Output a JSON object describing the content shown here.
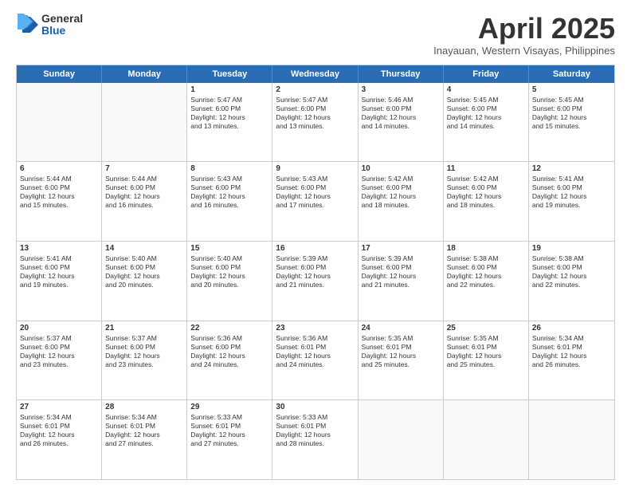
{
  "logo": {
    "general": "General",
    "blue": "Blue"
  },
  "title": "April 2025",
  "subtitle": "Inayauan, Western Visayas, Philippines",
  "header_days": [
    "Sunday",
    "Monday",
    "Tuesday",
    "Wednesday",
    "Thursday",
    "Friday",
    "Saturday"
  ],
  "weeks": [
    [
      {
        "day": "",
        "lines": []
      },
      {
        "day": "",
        "lines": []
      },
      {
        "day": "1",
        "lines": [
          "Sunrise: 5:47 AM",
          "Sunset: 6:00 PM",
          "Daylight: 12 hours",
          "and 13 minutes."
        ]
      },
      {
        "day": "2",
        "lines": [
          "Sunrise: 5:47 AM",
          "Sunset: 6:00 PM",
          "Daylight: 12 hours",
          "and 13 minutes."
        ]
      },
      {
        "day": "3",
        "lines": [
          "Sunrise: 5:46 AM",
          "Sunset: 6:00 PM",
          "Daylight: 12 hours",
          "and 14 minutes."
        ]
      },
      {
        "day": "4",
        "lines": [
          "Sunrise: 5:45 AM",
          "Sunset: 6:00 PM",
          "Daylight: 12 hours",
          "and 14 minutes."
        ]
      },
      {
        "day": "5",
        "lines": [
          "Sunrise: 5:45 AM",
          "Sunset: 6:00 PM",
          "Daylight: 12 hours",
          "and 15 minutes."
        ]
      }
    ],
    [
      {
        "day": "6",
        "lines": [
          "Sunrise: 5:44 AM",
          "Sunset: 6:00 PM",
          "Daylight: 12 hours",
          "and 15 minutes."
        ]
      },
      {
        "day": "7",
        "lines": [
          "Sunrise: 5:44 AM",
          "Sunset: 6:00 PM",
          "Daylight: 12 hours",
          "and 16 minutes."
        ]
      },
      {
        "day": "8",
        "lines": [
          "Sunrise: 5:43 AM",
          "Sunset: 6:00 PM",
          "Daylight: 12 hours",
          "and 16 minutes."
        ]
      },
      {
        "day": "9",
        "lines": [
          "Sunrise: 5:43 AM",
          "Sunset: 6:00 PM",
          "Daylight: 12 hours",
          "and 17 minutes."
        ]
      },
      {
        "day": "10",
        "lines": [
          "Sunrise: 5:42 AM",
          "Sunset: 6:00 PM",
          "Daylight: 12 hours",
          "and 18 minutes."
        ]
      },
      {
        "day": "11",
        "lines": [
          "Sunrise: 5:42 AM",
          "Sunset: 6:00 PM",
          "Daylight: 12 hours",
          "and 18 minutes."
        ]
      },
      {
        "day": "12",
        "lines": [
          "Sunrise: 5:41 AM",
          "Sunset: 6:00 PM",
          "Daylight: 12 hours",
          "and 19 minutes."
        ]
      }
    ],
    [
      {
        "day": "13",
        "lines": [
          "Sunrise: 5:41 AM",
          "Sunset: 6:00 PM",
          "Daylight: 12 hours",
          "and 19 minutes."
        ]
      },
      {
        "day": "14",
        "lines": [
          "Sunrise: 5:40 AM",
          "Sunset: 6:00 PM",
          "Daylight: 12 hours",
          "and 20 minutes."
        ]
      },
      {
        "day": "15",
        "lines": [
          "Sunrise: 5:40 AM",
          "Sunset: 6:00 PM",
          "Daylight: 12 hours",
          "and 20 minutes."
        ]
      },
      {
        "day": "16",
        "lines": [
          "Sunrise: 5:39 AM",
          "Sunset: 6:00 PM",
          "Daylight: 12 hours",
          "and 21 minutes."
        ]
      },
      {
        "day": "17",
        "lines": [
          "Sunrise: 5:39 AM",
          "Sunset: 6:00 PM",
          "Daylight: 12 hours",
          "and 21 minutes."
        ]
      },
      {
        "day": "18",
        "lines": [
          "Sunrise: 5:38 AM",
          "Sunset: 6:00 PM",
          "Daylight: 12 hours",
          "and 22 minutes."
        ]
      },
      {
        "day": "19",
        "lines": [
          "Sunrise: 5:38 AM",
          "Sunset: 6:00 PM",
          "Daylight: 12 hours",
          "and 22 minutes."
        ]
      }
    ],
    [
      {
        "day": "20",
        "lines": [
          "Sunrise: 5:37 AM",
          "Sunset: 6:00 PM",
          "Daylight: 12 hours",
          "and 23 minutes."
        ]
      },
      {
        "day": "21",
        "lines": [
          "Sunrise: 5:37 AM",
          "Sunset: 6:00 PM",
          "Daylight: 12 hours",
          "and 23 minutes."
        ]
      },
      {
        "day": "22",
        "lines": [
          "Sunrise: 5:36 AM",
          "Sunset: 6:00 PM",
          "Daylight: 12 hours",
          "and 24 minutes."
        ]
      },
      {
        "day": "23",
        "lines": [
          "Sunrise: 5:36 AM",
          "Sunset: 6:01 PM",
          "Daylight: 12 hours",
          "and 24 minutes."
        ]
      },
      {
        "day": "24",
        "lines": [
          "Sunrise: 5:35 AM",
          "Sunset: 6:01 PM",
          "Daylight: 12 hours",
          "and 25 minutes."
        ]
      },
      {
        "day": "25",
        "lines": [
          "Sunrise: 5:35 AM",
          "Sunset: 6:01 PM",
          "Daylight: 12 hours",
          "and 25 minutes."
        ]
      },
      {
        "day": "26",
        "lines": [
          "Sunrise: 5:34 AM",
          "Sunset: 6:01 PM",
          "Daylight: 12 hours",
          "and 26 minutes."
        ]
      }
    ],
    [
      {
        "day": "27",
        "lines": [
          "Sunrise: 5:34 AM",
          "Sunset: 6:01 PM",
          "Daylight: 12 hours",
          "and 26 minutes."
        ]
      },
      {
        "day": "28",
        "lines": [
          "Sunrise: 5:34 AM",
          "Sunset: 6:01 PM",
          "Daylight: 12 hours",
          "and 27 minutes."
        ]
      },
      {
        "day": "29",
        "lines": [
          "Sunrise: 5:33 AM",
          "Sunset: 6:01 PM",
          "Daylight: 12 hours",
          "and 27 minutes."
        ]
      },
      {
        "day": "30",
        "lines": [
          "Sunrise: 5:33 AM",
          "Sunset: 6:01 PM",
          "Daylight: 12 hours",
          "and 28 minutes."
        ]
      },
      {
        "day": "",
        "lines": []
      },
      {
        "day": "",
        "lines": []
      },
      {
        "day": "",
        "lines": []
      }
    ]
  ]
}
